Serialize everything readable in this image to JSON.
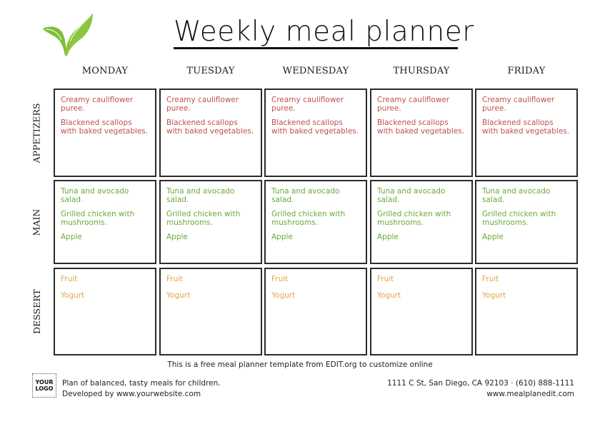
{
  "title": "Weekly meal planner",
  "logo_icon": "sprout-icon",
  "days": [
    "MONDAY",
    "TUESDAY",
    "WEDNESDAY",
    "THURSDAY",
    "FRIDAY"
  ],
  "rows": [
    {
      "label": "APPETIZERS",
      "key": "appetizers",
      "color": "#c0504d"
    },
    {
      "label": "MAIN",
      "key": "main",
      "color": "#6aaa3a"
    },
    {
      "label": "DESSERT",
      "key": "dessert",
      "color": "#e0a84a"
    }
  ],
  "meals": {
    "appetizers": [
      [
        "Creamy cauliflower puree.",
        "Blackened scallops with baked vegetables."
      ],
      [
        "Creamy cauliflower puree.",
        "Blackened scallops with baked vegetables."
      ],
      [
        "Creamy cauliflower puree.",
        "Blackened scallops with baked vegetables."
      ],
      [
        "Creamy cauliflower puree.",
        "Blackened scallops with baked vegetables."
      ],
      [
        "Creamy cauliflower puree.",
        "Blackened scallops with baked vegetables."
      ]
    ],
    "main": [
      [
        "Tuna and avocado salad.",
        "Grilled chicken with mushrooms.",
        "Apple"
      ],
      [
        "Tuna and avocado salad.",
        "Grilled chicken with mushrooms.",
        "Apple"
      ],
      [
        "Tuna and avocado salad.",
        "Grilled chicken with mushrooms.",
        "Apple"
      ],
      [
        "Tuna and avocado salad.",
        "Grilled chicken with mushrooms.",
        "Apple"
      ],
      [
        "Tuna and avocado salad.",
        "Grilled chicken with mushrooms.",
        "Apple"
      ]
    ],
    "dessert": [
      [
        "Fruit",
        "Yogurt"
      ],
      [
        "Fruit",
        "Yogurt"
      ],
      [
        "Fruit",
        "Yogurt"
      ],
      [
        "Fruit",
        "Yogurt"
      ],
      [
        "Fruit",
        "Yogurt"
      ]
    ]
  },
  "footer": {
    "note": "This is a free meal planner template from EDIT.org to customize online",
    "logo_line1": "YOUR",
    "logo_line2": "LOGO",
    "tagline": "Plan of balanced, tasty meals for children.",
    "developer": "Developed by www.yourwebsite.com",
    "address": "1111 C St, San Diego, CA 92103 · (610) 888-1111",
    "website": "www.mealplanedit.com"
  }
}
